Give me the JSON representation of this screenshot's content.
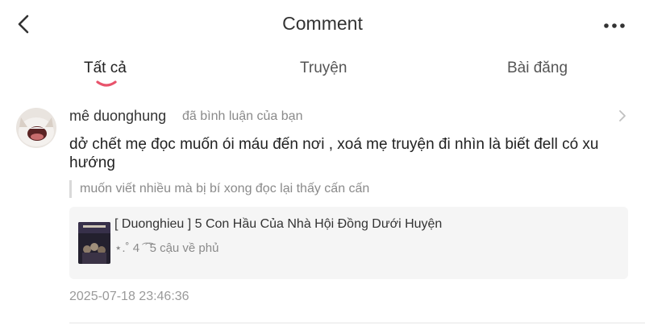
{
  "header": {
    "title": "Comment",
    "back_icon": "chevron-left-icon",
    "more_icon": "more-horizontal-icon"
  },
  "tabs": [
    {
      "label": "Tất cả",
      "active": true
    },
    {
      "label": "Truyện",
      "active": false
    },
    {
      "label": "Bài đăng",
      "active": false
    }
  ],
  "accent_color": "#e8536b",
  "notification": {
    "user_name": "mê duonghung",
    "action": "đã bình luận của bạn",
    "comment_text": "dở chết mẹ đọc muốn ói máu đến nơi , xoá mẹ truyện đi nhìn là biết đell có xu hướng",
    "quoted_text": "muốn viết nhiều mà bị bí xong đọc lại thấy cấn cấn",
    "story": {
      "title": "[ Duonghieu ] 5 Con Hầu Của Nhà Hội Đồng Dưới Huyện",
      "subtitle": "⋆.˚ 4 ͡ ͡ 5 cậu về phủ"
    },
    "timestamp": "2025-07-18 23:46:36"
  }
}
